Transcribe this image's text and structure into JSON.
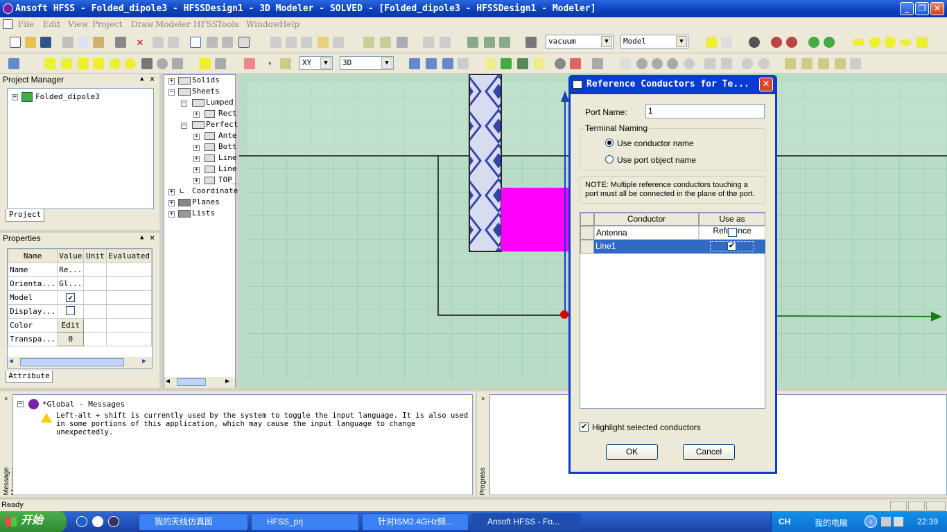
{
  "window": {
    "title": "Ansoft HFSS - Folded_dipole3 - HFSSDesign1 - 3D Modeler - SOLVED - [Folded_dipole3 - HFSSDesign1 - Modeler]"
  },
  "menu": [
    "File",
    "Edit",
    "View",
    "Project",
    "Draw",
    "Modeler",
    "HFSS",
    "Tools",
    "Window",
    "Help"
  ],
  "toolbar": {
    "material": "vacuum",
    "model": "Model",
    "plane": "XY",
    "view": "3D"
  },
  "project_manager": {
    "header": "Project Manager",
    "project": "Folded_dipole3",
    "tab": "Project"
  },
  "model_tree": {
    "items": [
      "Solids",
      "Sheets",
      "Lumped",
      "Rect",
      "Perfect",
      "Ante",
      "Bott",
      "Line",
      "Line",
      "TOP_",
      "Coordinate",
      "Planes",
      "Lists"
    ]
  },
  "properties": {
    "header": "Properties",
    "columns": [
      "Name",
      "Value",
      "Unit",
      "Evaluated"
    ],
    "rows": [
      {
        "name": "Name",
        "value": "Re..."
      },
      {
        "name": "Orienta...",
        "value": "Gl..."
      },
      {
        "name": "Model",
        "value": "✔"
      },
      {
        "name": "Display...",
        "value": ""
      },
      {
        "name": "Color",
        "value": "Edit"
      },
      {
        "name": "Transpa...",
        "value": "0"
      }
    ],
    "tab": "Attribute"
  },
  "messages": {
    "root": "*Global - Messages",
    "text": "Left-alt + shift is currently used by the system to toggle the input language. It is also used in some portions of this application, which may cause the input language to change unexpectedly.",
    "side_label": "Message Manager"
  },
  "progress": {
    "side_label": "Progress"
  },
  "status": {
    "text": "Ready"
  },
  "dialog": {
    "title": "Reference Conductors for Te...",
    "port_name_label": "Port Name:",
    "port_name_value": "1",
    "group_label": "Terminal Naming",
    "radio1": "Use conductor name",
    "radio2": "Use port object name",
    "note": "NOTE: Multiple reference conductors touching a port must all be connected in the plane of the port.",
    "table_headers": [
      "Conductor",
      "Use as Reference"
    ],
    "rows": [
      {
        "conductor": "Antenna",
        "ref": false
      },
      {
        "conductor": "Line1",
        "ref": true
      }
    ],
    "highlight_label": "Highlight selected conductors",
    "ok": "OK",
    "cancel": "Cancel"
  },
  "taskbar": {
    "start": "开始",
    "tasks": [
      "我的天线仿真图",
      "HFSS_prj",
      "针对ISM2.4GHz频...",
      "Ansoft HFSS - Fo..."
    ],
    "lang": "CH",
    "computer": "我的电脑",
    "clock": "22:39"
  },
  "colors": {
    "viewport": "#b9dcc6",
    "port": "#ff00ff",
    "selection": "#316ac5",
    "titlebar": "#0a3bd0"
  }
}
